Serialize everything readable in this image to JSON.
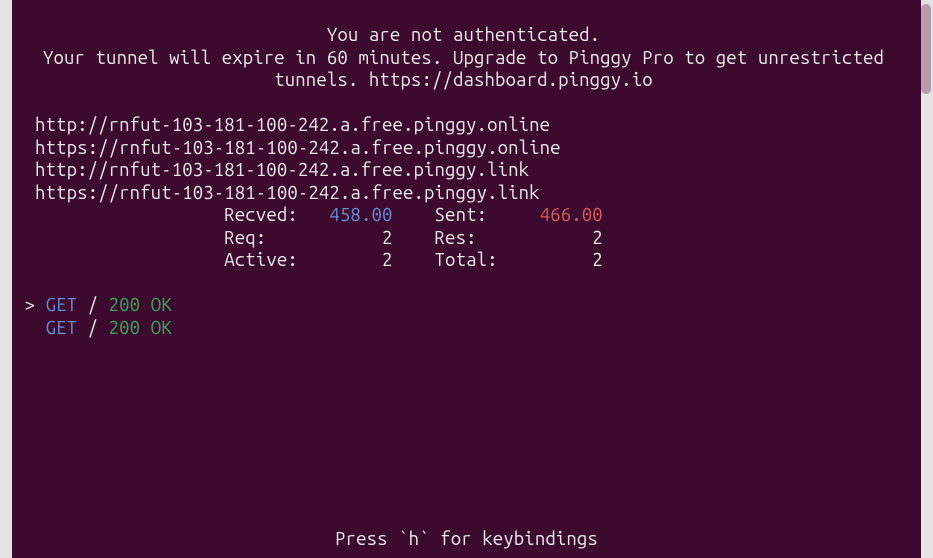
{
  "header": {
    "line1": "You are not authenticated.",
    "line2": "Your tunnel will expire in 60 minutes. Upgrade to Pinggy Pro to get unrestricted",
    "line3": "tunnels. https://dashboard.pinggy.io"
  },
  "urls": [
    "http://rnfut-103-181-100-242.a.free.pinggy.online",
    "https://rnfut-103-181-100-242.a.free.pinggy.online",
    "http://rnfut-103-181-100-242.a.free.pinggy.link",
    "https://rnfut-103-181-100-242.a.free.pinggy.link"
  ],
  "stats": {
    "recved_label": "Recved:",
    "recved_value": "458.00",
    "sent_label": "Sent:",
    "sent_value": "466.00",
    "req_label": "Req:",
    "req_value": "2",
    "res_label": "Res:",
    "res_value": "2",
    "active_label": "Active:",
    "active_value": "2",
    "total_label": "Total:",
    "total_value": "2"
  },
  "requests": [
    {
      "prefix": "> ",
      "method": "GET",
      "path": "/",
      "status": "200 OK"
    },
    {
      "prefix": "  ",
      "method": "GET",
      "path": "/",
      "status": "200 OK"
    }
  ],
  "footer": "Press `h` for keybindings"
}
